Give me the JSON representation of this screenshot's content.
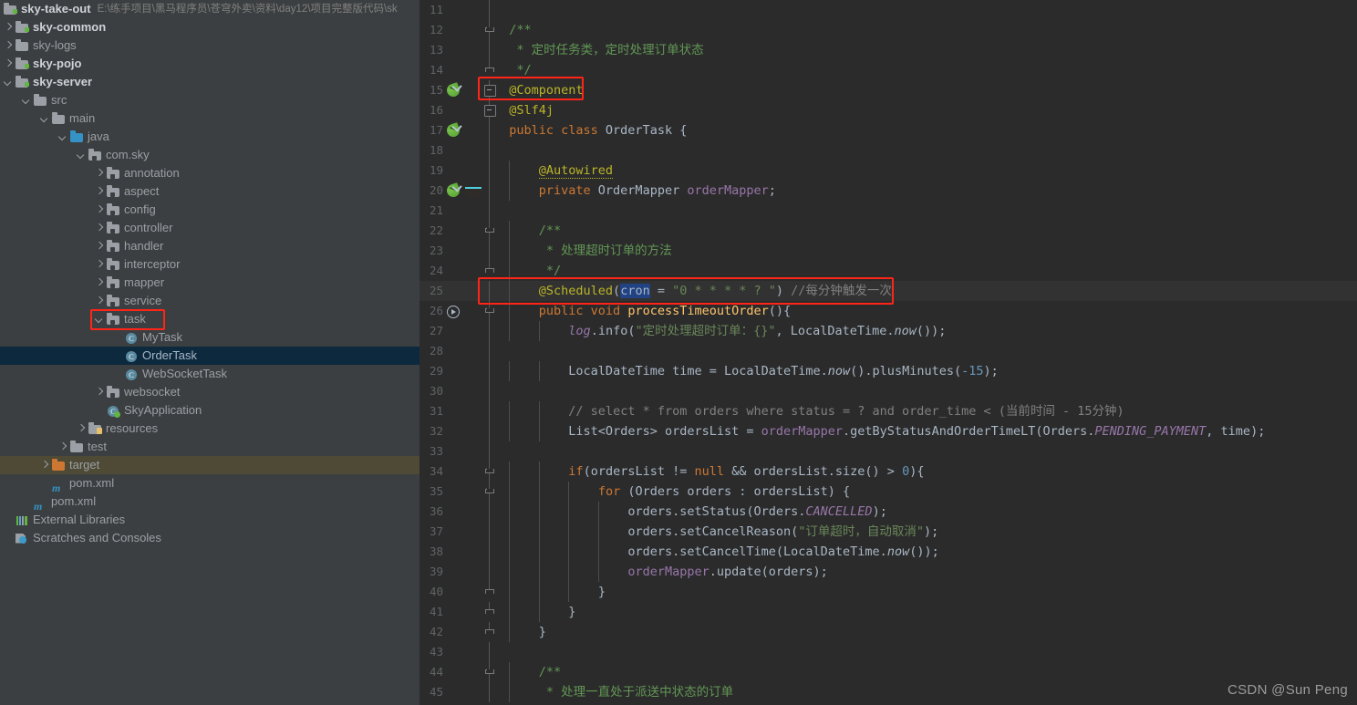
{
  "project": {
    "root_label": "sky-take-out",
    "root_path": "E:\\练手项目\\黑马程序员\\苍穹外卖\\资料\\day12\\项目完整版代码\\sk",
    "items": [
      {
        "label": "sky-common",
        "indent": 1,
        "arrow": "right",
        "icon": "module-folder-icon",
        "style": "bold"
      },
      {
        "label": "sky-logs",
        "indent": 1,
        "arrow": "right",
        "icon": "folder-icon",
        "style": "dim"
      },
      {
        "label": "sky-pojo",
        "indent": 1,
        "arrow": "right",
        "icon": "module-folder-icon",
        "style": "bold"
      },
      {
        "label": "sky-server",
        "indent": 1,
        "arrow": "down",
        "icon": "module-folder-icon",
        "style": "bold"
      },
      {
        "label": "src",
        "indent": 2,
        "arrow": "down",
        "icon": "folder-icon",
        "style": "dim"
      },
      {
        "label": "main",
        "indent": 3,
        "arrow": "down",
        "icon": "folder-icon",
        "style": "dim"
      },
      {
        "label": "java",
        "indent": 4,
        "arrow": "down",
        "icon": "source-folder-icon",
        "style": "dim"
      },
      {
        "label": "com.sky",
        "indent": 5,
        "arrow": "down",
        "icon": "package-icon",
        "style": "dim"
      },
      {
        "label": "annotation",
        "indent": 6,
        "arrow": "right",
        "icon": "package-icon",
        "style": "dim"
      },
      {
        "label": "aspect",
        "indent": 6,
        "arrow": "right",
        "icon": "package-icon",
        "style": "dim"
      },
      {
        "label": "config",
        "indent": 6,
        "arrow": "right",
        "icon": "package-icon",
        "style": "dim"
      },
      {
        "label": "controller",
        "indent": 6,
        "arrow": "right",
        "icon": "package-icon",
        "style": "dim"
      },
      {
        "label": "handler",
        "indent": 6,
        "arrow": "right",
        "icon": "package-icon",
        "style": "dim"
      },
      {
        "label": "interceptor",
        "indent": 6,
        "arrow": "right",
        "icon": "package-icon",
        "style": "dim"
      },
      {
        "label": "mapper",
        "indent": 6,
        "arrow": "right",
        "icon": "package-icon",
        "style": "dim"
      },
      {
        "label": "service",
        "indent": 6,
        "arrow": "right",
        "icon": "package-icon",
        "style": "dim"
      },
      {
        "label": "task",
        "indent": 6,
        "arrow": "down",
        "icon": "package-icon",
        "style": "dim",
        "annotated": true
      },
      {
        "label": "MyTask",
        "indent": 7,
        "arrow": "none",
        "icon": "java-class-icon",
        "style": "dim"
      },
      {
        "label": "OrderTask",
        "indent": 7,
        "arrow": "none",
        "icon": "java-class-icon",
        "style": "plain",
        "selected": true
      },
      {
        "label": "WebSocketTask",
        "indent": 7,
        "arrow": "none",
        "icon": "java-class-icon",
        "style": "dim"
      },
      {
        "label": "websocket",
        "indent": 6,
        "arrow": "right",
        "icon": "package-icon",
        "style": "dim"
      },
      {
        "label": "SkyApplication",
        "indent": 6,
        "arrow": "none",
        "icon": "spring-class-icon",
        "style": "dim"
      },
      {
        "label": "resources",
        "indent": 5,
        "arrow": "right",
        "icon": "resources-folder-icon",
        "style": "dim"
      },
      {
        "label": "test",
        "indent": 4,
        "arrow": "right",
        "icon": "folder-icon",
        "style": "dim"
      },
      {
        "label": "target",
        "indent": 3,
        "arrow": "right",
        "icon": "target-folder-icon",
        "style": "dim",
        "hovered": true
      },
      {
        "label": "pom.xml",
        "indent": 3,
        "arrow": "none",
        "icon": "maven-icon",
        "style": "dim"
      },
      {
        "label": "pom.xml",
        "indent": 2,
        "arrow": "none",
        "icon": "maven-icon",
        "style": "dim"
      },
      {
        "label": "External Libraries",
        "indent": 1,
        "arrow": "none",
        "icon": "libraries-icon",
        "style": "dim"
      },
      {
        "label": "Scratches and Consoles",
        "indent": 1,
        "arrow": "none",
        "icon": "scratches-icon",
        "style": "dim"
      }
    ]
  },
  "editor": {
    "first_line_number": 11,
    "lines": [
      {
        "n": 11,
        "fold": "line",
        "gutter": [],
        "tokens": []
      },
      {
        "n": 12,
        "fold": "cap",
        "gutter": [],
        "tokens": [
          {
            "t": "/**",
            "c": "doc",
            "i": 2
          }
        ]
      },
      {
        "n": 13,
        "fold": "line",
        "gutter": [],
        "tokens": [
          {
            "t": " * 定时任务类，定时处理订单状态",
            "c": "doc",
            "i": 2
          }
        ]
      },
      {
        "n": 14,
        "fold": "end",
        "gutter": [],
        "tokens": [
          {
            "t": " */",
            "c": "doc",
            "i": 2
          }
        ]
      },
      {
        "n": 15,
        "fold": "box",
        "gutter": [
          "spring-bean-icon"
        ],
        "tokens": [
          {
            "t": "@Component",
            "c": "ann",
            "i": 2
          }
        ],
        "annotated": true
      },
      {
        "n": 16,
        "fold": "box",
        "gutter": [],
        "tokens": [
          {
            "t": "@Slf4j",
            "c": "ann",
            "i": 2
          }
        ]
      },
      {
        "n": 17,
        "fold": "line",
        "gutter": [
          "spring-bean-icon"
        ],
        "tokens": [
          {
            "t": "public class ",
            "c": "kw",
            "i": 2
          },
          {
            "t": "OrderTask ",
            "c": "pl"
          },
          {
            "t": "{",
            "c": "pl"
          }
        ]
      },
      {
        "n": 18,
        "fold": "line",
        "gutter": [],
        "tokens": []
      },
      {
        "n": 19,
        "fold": "line",
        "gutter": [],
        "tokens": [
          {
            "t": "@Autowired",
            "c": "ann wavy",
            "i": 6
          }
        ]
      },
      {
        "n": 20,
        "fold": "line",
        "gutter": [
          "spring-bean-icon",
          "spring-autowire-icon"
        ],
        "tokens": [
          {
            "t": "private ",
            "c": "kw",
            "i": 6
          },
          {
            "t": "OrderMapper ",
            "c": "pl"
          },
          {
            "t": "orderMapper",
            "c": "fld2"
          },
          {
            "t": ";",
            "c": "pl"
          }
        ]
      },
      {
        "n": 21,
        "fold": "line",
        "gutter": [],
        "tokens": []
      },
      {
        "n": 22,
        "fold": "cap",
        "gutter": [],
        "tokens": [
          {
            "t": "/**",
            "c": "doc",
            "i": 6
          }
        ]
      },
      {
        "n": 23,
        "fold": "line",
        "gutter": [],
        "tokens": [
          {
            "t": " * 处理超时订单的方法",
            "c": "doc",
            "i": 6
          }
        ]
      },
      {
        "n": 24,
        "fold": "end",
        "gutter": [],
        "tokens": [
          {
            "t": " */",
            "c": "doc",
            "i": 6
          }
        ]
      },
      {
        "n": 25,
        "fold": "line",
        "gutter": [],
        "current": true,
        "annotated": true,
        "tokens": [
          {
            "t": "@Scheduled",
            "c": "ann",
            "i": 6
          },
          {
            "t": "(",
            "c": "pl"
          },
          {
            "t": "cron",
            "c": "ann sel-tok"
          },
          {
            "t": " = ",
            "c": "pl"
          },
          {
            "t": "\"0 * * * * ? \"",
            "c": "str"
          },
          {
            "t": ")",
            "c": "pl"
          },
          {
            "t": " //每分钟触发一次",
            "c": "cmt"
          }
        ]
      },
      {
        "n": 26,
        "fold": "cap",
        "gutter": [
          "run-method-icon"
        ],
        "tokens": [
          {
            "t": "public void ",
            "c": "kw",
            "i": 6
          },
          {
            "t": "processTimeoutOrder",
            "c": "meth"
          },
          {
            "t": "(){",
            "c": "pl"
          }
        ]
      },
      {
        "n": 27,
        "fold": "line",
        "gutter": [],
        "tokens": [
          {
            "t": "log",
            "c": "stat",
            "i": 10
          },
          {
            "t": ".info(",
            "c": "pl"
          },
          {
            "t": "\"定时处理超时订单：{}\"",
            "c": "str"
          },
          {
            "t": ", LocalDateTime.",
            "c": "pl"
          },
          {
            "t": "now",
            "c": "pl italic"
          },
          {
            "t": "());",
            "c": "pl"
          }
        ]
      },
      {
        "n": 28,
        "fold": "line",
        "gutter": [],
        "tokens": []
      },
      {
        "n": 29,
        "fold": "line",
        "gutter": [],
        "tokens": [
          {
            "t": "LocalDateTime time = LocalDateTime.",
            "c": "pl",
            "i": 10
          },
          {
            "t": "now",
            "c": "pl italic"
          },
          {
            "t": "().plusMinutes(",
            "c": "pl"
          },
          {
            "t": "-15",
            "c": "num"
          },
          {
            "t": ");",
            "c": "pl"
          }
        ]
      },
      {
        "n": 30,
        "fold": "line",
        "gutter": [],
        "tokens": []
      },
      {
        "n": 31,
        "fold": "line",
        "gutter": [],
        "tokens": [
          {
            "t": "// select * from orders where status = ? and order_time < (当前时间 - 15分钟)",
            "c": "cmt",
            "i": 10
          }
        ]
      },
      {
        "n": 32,
        "fold": "line",
        "gutter": [],
        "tokens": [
          {
            "t": "List<Orders> ordersList = ",
            "c": "pl",
            "i": 10
          },
          {
            "t": "orderMapper",
            "c": "fld2"
          },
          {
            "t": ".getByStatusAndOrderTimeLT(Orders.",
            "c": "pl"
          },
          {
            "t": "PENDING_PAYMENT",
            "c": "stat"
          },
          {
            "t": ", time);",
            "c": "pl"
          }
        ]
      },
      {
        "n": 33,
        "fold": "line",
        "gutter": [],
        "tokens": []
      },
      {
        "n": 34,
        "fold": "cap",
        "gutter": [],
        "tokens": [
          {
            "t": "if",
            "c": "kw",
            "i": 10
          },
          {
            "t": "(ordersList != ",
            "c": "pl"
          },
          {
            "t": "null",
            "c": "kw"
          },
          {
            "t": " && ordersList.size() > ",
            "c": "pl"
          },
          {
            "t": "0",
            "c": "num"
          },
          {
            "t": "){",
            "c": "pl"
          }
        ]
      },
      {
        "n": 35,
        "fold": "cap",
        "gutter": [],
        "tokens": [
          {
            "t": "for",
            "c": "kw",
            "i": 14
          },
          {
            "t": " (Orders orders : ordersList) {",
            "c": "pl"
          }
        ]
      },
      {
        "n": 36,
        "fold": "line",
        "gutter": [],
        "tokens": [
          {
            "t": "orders.setStatus(Orders.",
            "c": "pl",
            "i": 18
          },
          {
            "t": "CANCELLED",
            "c": "stat"
          },
          {
            "t": ");",
            "c": "pl"
          }
        ]
      },
      {
        "n": 37,
        "fold": "line",
        "gutter": [],
        "tokens": [
          {
            "t": "orders.setCancelReason(",
            "c": "pl",
            "i": 18
          },
          {
            "t": "\"订单超时，自动取消\"",
            "c": "str"
          },
          {
            "t": ");",
            "c": "pl"
          }
        ]
      },
      {
        "n": 38,
        "fold": "line",
        "gutter": [],
        "tokens": [
          {
            "t": "orders.setCancelTime(LocalDateTime.",
            "c": "pl",
            "i": 18
          },
          {
            "t": "now",
            "c": "pl italic"
          },
          {
            "t": "());",
            "c": "pl"
          }
        ]
      },
      {
        "n": 39,
        "fold": "line",
        "gutter": [],
        "tokens": [
          {
            "t": "orderMapper",
            "c": "fld2",
            "i": 18
          },
          {
            "t": ".update(orders);",
            "c": "pl"
          }
        ]
      },
      {
        "n": 40,
        "fold": "end",
        "gutter": [],
        "tokens": [
          {
            "t": "}",
            "c": "pl",
            "i": 14
          }
        ]
      },
      {
        "n": 41,
        "fold": "end",
        "gutter": [],
        "tokens": [
          {
            "t": "}",
            "c": "pl",
            "i": 10
          }
        ]
      },
      {
        "n": 42,
        "fold": "end",
        "gutter": [],
        "tokens": [
          {
            "t": "}",
            "c": "pl",
            "i": 6
          }
        ]
      },
      {
        "n": 43,
        "fold": "line",
        "gutter": [],
        "tokens": []
      },
      {
        "n": 44,
        "fold": "cap",
        "gutter": [],
        "tokens": [
          {
            "t": "/**",
            "c": "doc",
            "i": 6
          }
        ]
      },
      {
        "n": 45,
        "fold": "line",
        "gutter": [],
        "tokens": [
          {
            "t": " * 处理一直处于派送中状态的订单",
            "c": "doc",
            "i": 6
          }
        ]
      }
    ]
  },
  "watermark": "CSDN @Sun  Peng",
  "colors": {
    "annotation_box": "#ff2418",
    "tree_bg": "#3c3f41",
    "editor_bg": "#2b2b2b",
    "selected_row": "#0d293e",
    "hovered_row": "#4e4a35",
    "current_line": "#323232",
    "token_selection": "#214283"
  }
}
